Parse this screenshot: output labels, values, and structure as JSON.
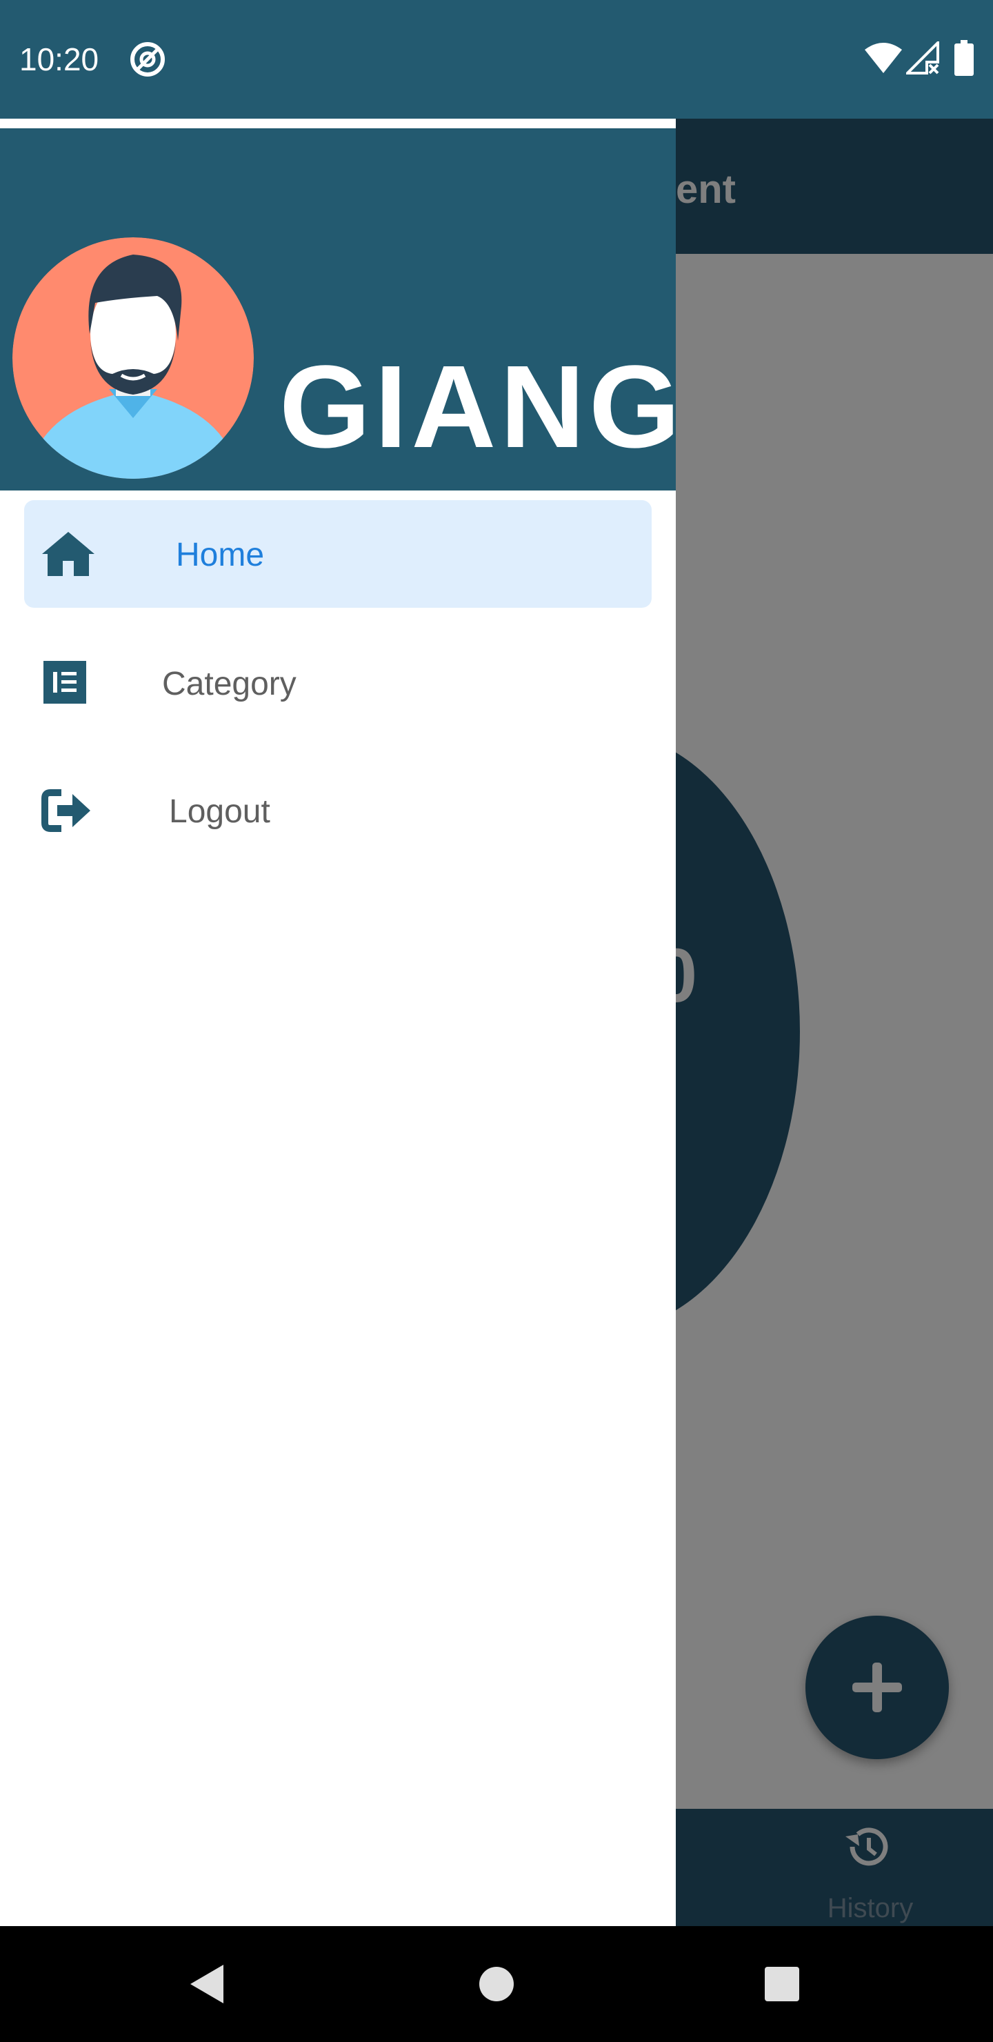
{
  "status_bar": {
    "time": "10:20",
    "icons": [
      "do-not-disturb-icon",
      "wifi-icon",
      "signal-no-data-icon",
      "battery-icon"
    ]
  },
  "background_app": {
    "title_fragment": "ent",
    "circle_value_fragment": "0",
    "fab_icon": "plus-icon",
    "bottom_nav": {
      "history_label": "History",
      "history_icon": "history-icon"
    }
  },
  "drawer": {
    "user_name": "GIANG",
    "avatar_icon": "avatar-illustration-icon",
    "items": [
      {
        "label": "Home",
        "icon": "home-icon",
        "selected": true
      },
      {
        "label": "Category",
        "icon": "category-list-icon",
        "selected": false
      },
      {
        "label": "Logout",
        "icon": "logout-icon",
        "selected": false
      }
    ]
  },
  "android_nav": {
    "buttons": [
      "back",
      "home",
      "recents"
    ]
  },
  "colors": {
    "primary": "#235a70",
    "dark_primary": "#132b38",
    "selected_bg": "#dfeefd",
    "selected_text": "#1f7fdc",
    "scrim": "#808080",
    "avatar_bg": "#ff8a6e"
  }
}
